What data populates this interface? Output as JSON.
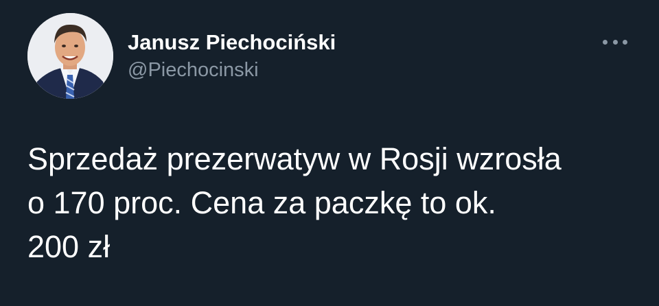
{
  "author": {
    "display_name": "Janusz Piechociński",
    "handle": "@Piechocinski",
    "avatar_icon": "profile-photo"
  },
  "menu": {
    "icon": "more-horizontal-icon"
  },
  "tweet": {
    "lines": [
      "Sprzedaż prezerwatyw w Rosji wzrosła",
      "o 170 proc. Cena za paczkę to ok.",
      "200 zł"
    ]
  },
  "colors": {
    "background": "#15202b",
    "text_primary": "#ffffff",
    "text_secondary": "#8b98a5"
  }
}
